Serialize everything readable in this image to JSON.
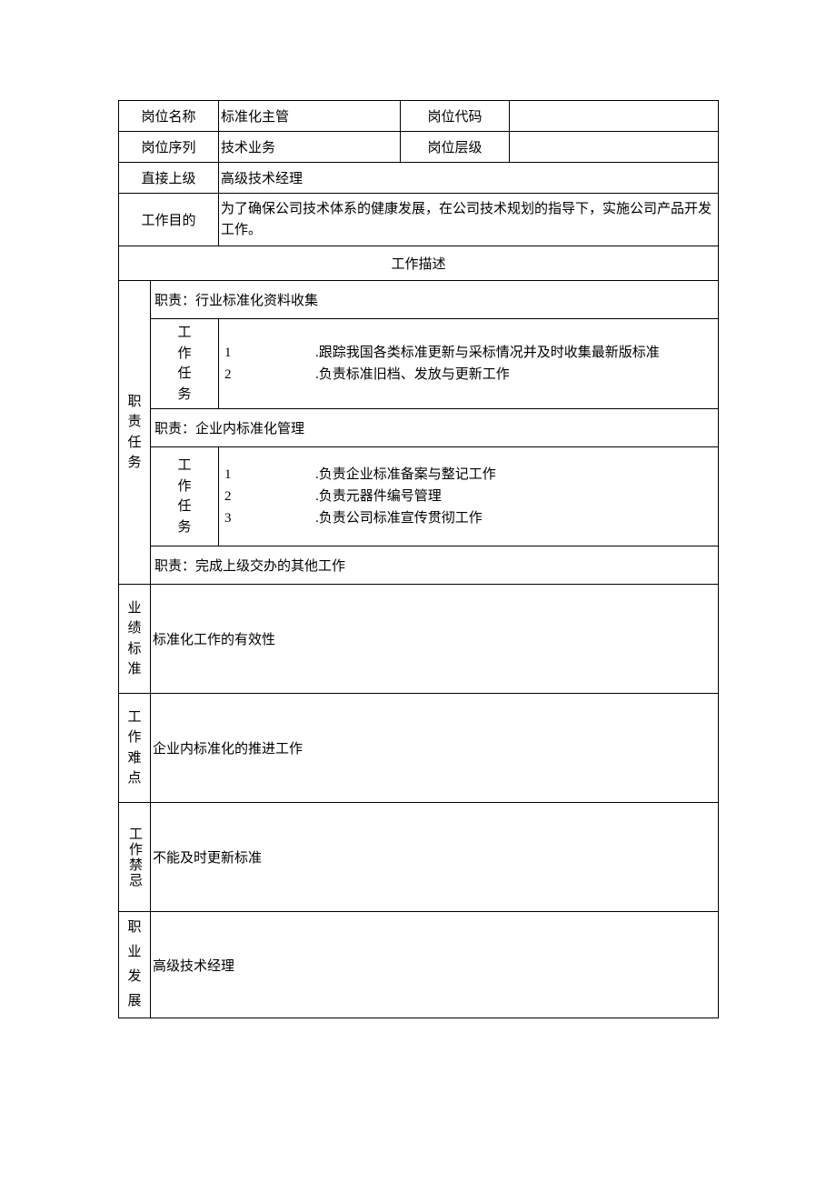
{
  "header": {
    "positionNameLabel": "岗位名称",
    "positionNameValue": "标准化主管",
    "positionCodeLabel": "岗位代码",
    "positionCodeValue": "",
    "positionSeriesLabel": "岗位序列",
    "positionSeriesValue": "技术业务",
    "positionLevelLabel": "岗位层级",
    "positionLevelValue": "",
    "directSuperiorLabel": "直接上级",
    "directSuperiorValue": "高级技术经理",
    "workPurposeLabel": "工作目的",
    "workPurposeValue": "为了确保公司技术体系的健康发展，在公司技术规划的指导下，实施公司产品开发工作。"
  },
  "descHeader": "工作描述",
  "dutyLabel": "职责任务",
  "duty1": {
    "title": "职责：行业标准化资料收集",
    "taskLabel": "工作任务",
    "tasks": [
      {
        "num": "1",
        "text": ".跟踪我国各类标准更新与采标情况并及时收集最新版标准"
      },
      {
        "num": "2",
        "text": ".负责标准旧档、发放与更新工作"
      }
    ]
  },
  "duty2": {
    "title": "职责：企业内标准化管理",
    "taskLabel": "工作任务",
    "tasks": [
      {
        "num": "1",
        "text": ".负责企业标准备案与整记工作"
      },
      {
        "num": "2",
        "text": ".负责元器件编号管理"
      },
      {
        "num": "3",
        "text": ".负责公司标准宣传贯彻工作"
      }
    ]
  },
  "duty3": {
    "title": "职责：完成上级交办的其他工作"
  },
  "perf": {
    "label": "业绩标准",
    "value": "标准化工作的有效性"
  },
  "difficulty": {
    "label": "工作难点",
    "value": "企业内标准化的推进工作"
  },
  "taboo": {
    "label": "工作禁忌",
    "value": "不能及时更新标准"
  },
  "career": {
    "label": "职业发展",
    "value": "高级技术经理"
  }
}
